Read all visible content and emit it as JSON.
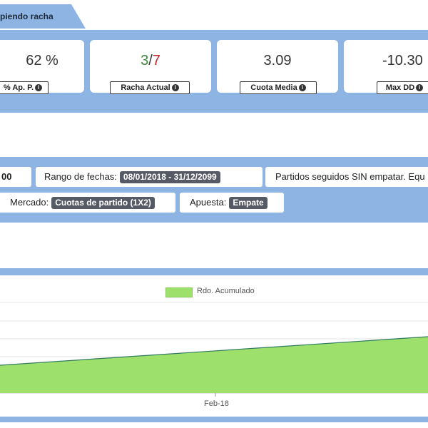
{
  "tab": {
    "title": "piendo racha"
  },
  "stats": {
    "cards": [
      {
        "value": "62 %",
        "label": "% Ap. P."
      },
      {
        "value_a": "3",
        "sep": "/",
        "value_b": "7",
        "label": "Racha Actual"
      },
      {
        "value": "3.09",
        "label": "Cuota Media"
      },
      {
        "value": "-10.30",
        "label": "Max DD"
      }
    ],
    "info_icon": "info-icon"
  },
  "filters": {
    "chip_partial": "00",
    "date_range_label": "Rango de fechas:",
    "date_range_value": "08/01/2018 - 31/12/2099",
    "strategy_text": "Partidos seguidos SIN empatar. Equ",
    "market_label": "Mercado:",
    "market_value": "Cuotas de partido (1X2)",
    "bet_label": "Apuesta:",
    "bet_value": "Empate"
  },
  "chart_data": {
    "type": "area",
    "series": [
      {
        "name": "Rdo. Acumulado",
        "color": "#9ee06c"
      }
    ],
    "x_ticks": [
      "Feb-18"
    ],
    "legend_position": "top-center",
    "grid": true
  },
  "colors": {
    "band": "#8db4e2",
    "positive": "#3c8a3c",
    "negative": "#c0282d",
    "area": "#9ee06c"
  }
}
